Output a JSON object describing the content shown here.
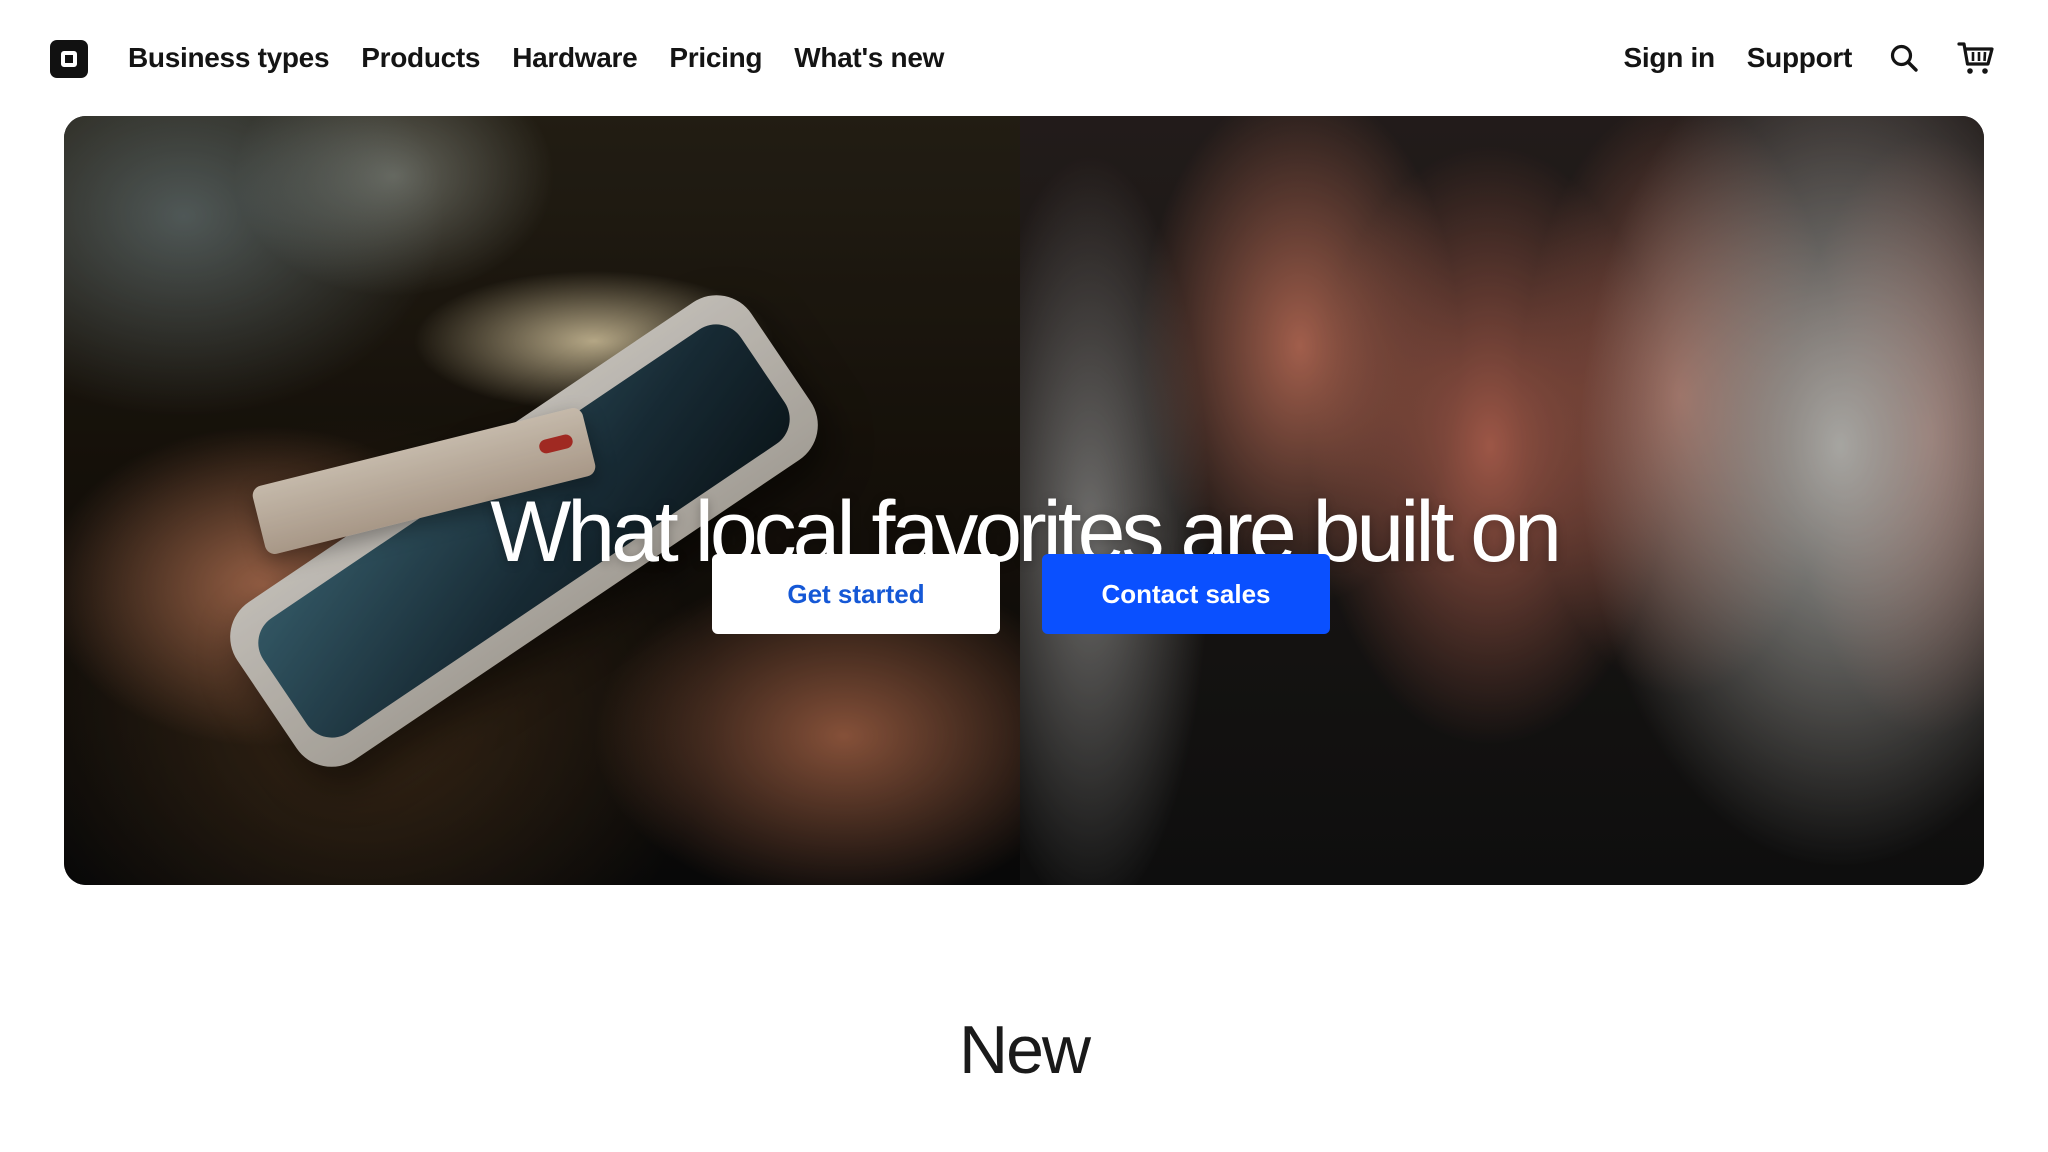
{
  "nav": {
    "logo_icon": "square-logo-icon",
    "left_links": [
      "Business types",
      "Products",
      "Hardware",
      "Pricing",
      "What's new"
    ],
    "right_links": [
      "Sign in",
      "Support"
    ],
    "icons": [
      "search-icon",
      "cart-icon"
    ]
  },
  "hero": {
    "title": "What local favorites are built on",
    "get_started_label": "Get started",
    "contact_sales_label": "Contact sales"
  },
  "section": {
    "title": "New"
  },
  "colors": {
    "accent_blue": "#0a50ff",
    "link_blue": "#1558d6",
    "text_dark": "#141414"
  }
}
